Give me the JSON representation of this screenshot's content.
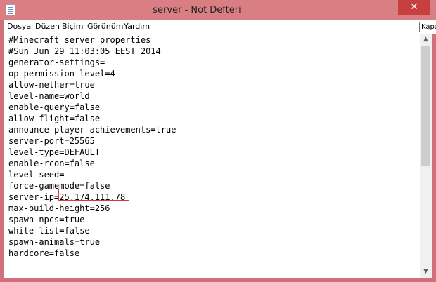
{
  "window": {
    "title": "server - Not Defteri",
    "close_symbol": "✕",
    "tooltip": "Kapat",
    "icon": "notepad-icon"
  },
  "menu": {
    "items": [
      "Dosya",
      "Düzen",
      "Biçim",
      "Görünüm",
      "Yardım"
    ]
  },
  "editor": {
    "lines": [
      "#Minecraft server properties",
      "#Sun Jun 29 11:03:05 EEST 2014",
      "generator-settings=",
      "op-permission-level=4",
      "allow-nether=true",
      "level-name=world",
      "enable-query=false",
      "allow-flight=false",
      "announce-player-achievements=true",
      "server-port=25565",
      "level-type=DEFAULT",
      "enable-rcon=false",
      "level-seed=",
      "force-gamemode=false",
      "server-ip=25.174.111.78",
      "max-build-height=256",
      "spawn-npcs=true",
      "white-list=false",
      "spawn-animals=true",
      "hardcore=false"
    ],
    "highlighted_value": "25.174.111.78"
  },
  "scrollbar": {
    "up_arrow": "▲",
    "down_arrow": "▼"
  },
  "colors": {
    "titlebar": "#d97f83",
    "close_button": "#c7403f",
    "highlight_border": "#d93a3a"
  }
}
